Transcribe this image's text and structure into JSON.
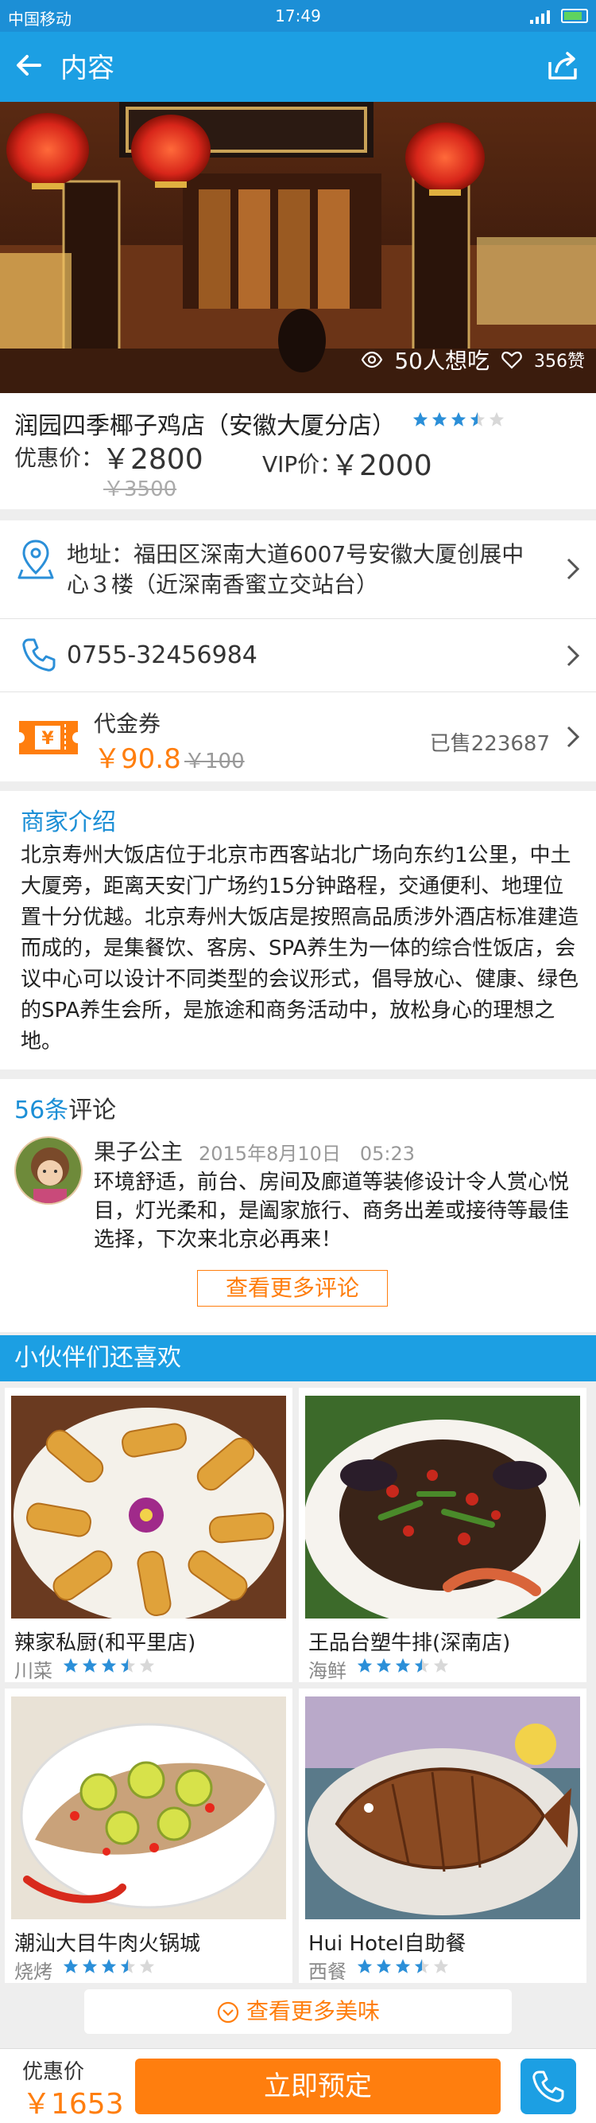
{
  "status_bar": {
    "carrier": "中国移动",
    "time": "17:49"
  },
  "nav": {
    "title": "内容"
  },
  "hero": {
    "want_to_eat": "50人想吃",
    "likes": "356赞"
  },
  "shop": {
    "name": "润园四季椰子鸡店（安徽大厦分店）",
    "rating": 3.5,
    "discount_label": "优惠价：",
    "discount_price": "￥2800",
    "original_price": "￥3500",
    "vip_label": "VIP价：",
    "vip_price": "￥2000"
  },
  "info": {
    "address": "地址：福田区深南大道6007号安徽大厦创展中心３楼（近深南香蜜立交站台）",
    "phone": "0755-32456984",
    "coupon_label": "代金券",
    "coupon_price": "￥90.8",
    "coupon_original": "￥100",
    "coupon_sold": "已售223687"
  },
  "intro": {
    "heading": "商家介绍",
    "text": "北京寿州大饭店位于北京市西客站北广场向东约1公里，中土大厦旁，距离天安门广场约15分钟路程，交通便利、地理位置十分优越。北京寿州大饭店是按照高品质涉外酒店标准建造而成的，是集餐饮、客房、SPA养生为一体的综合性饭店，会议中心可以设计不同类型的会议形式，倡导放心、健康、绿色的SPA养生会所，是旅途和商务活动中，放松身心的理想之地。"
  },
  "reviews": {
    "count": "56条",
    "label": "评论",
    "user": "果子公主",
    "date": "2015年8月10日　05:23",
    "comment": "环境舒适，前台、房间及廊道等装修设计令人赏心悦目，灯光柔和，是阖家旅行、商务出差或接待等最佳选择，下次来北京必再来！",
    "more_button": "查看更多评论"
  },
  "recommend": {
    "heading": "小伙伴们还喜欢",
    "items": [
      {
        "name": "辣家私厨(和平里店)",
        "category": "川菜",
        "rating": 3.5
      },
      {
        "name": "王品台塑牛排(深南店)",
        "category": "海鲜",
        "rating": 3.5
      },
      {
        "name": "潮汕大目牛肉火锅城",
        "category": "烧烤",
        "rating": 3.5
      },
      {
        "name": "Hui Hotel自助餐",
        "category": "西餐",
        "rating": 3.5
      }
    ],
    "more_button": "查看更多美味"
  },
  "bottom": {
    "price_label": "优惠价",
    "price": "￥1653",
    "book_button": "立即预定"
  },
  "colors": {
    "primary": "#1c9fe3",
    "accent": "#ff7e0e",
    "star": "#2b8fd8"
  }
}
